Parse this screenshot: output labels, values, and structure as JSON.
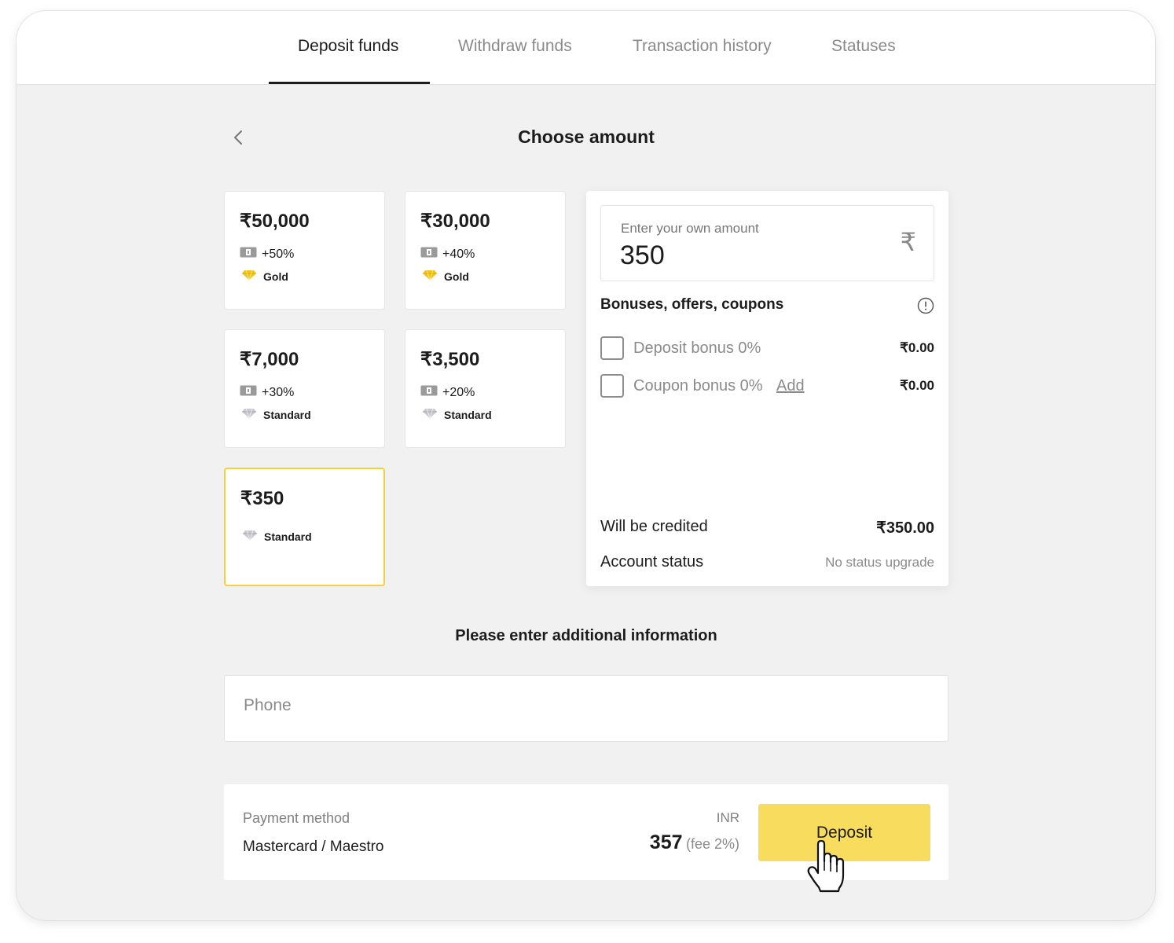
{
  "tabs": [
    {
      "label": "Deposit funds",
      "active": true
    },
    {
      "label": "Withdraw funds",
      "active": false
    },
    {
      "label": "Transaction history",
      "active": false
    },
    {
      "label": "Statuses",
      "active": false
    }
  ],
  "header": {
    "title": "Choose amount",
    "back_icon": "chevron-left-icon"
  },
  "amount_cards": [
    {
      "amount": "₹50,000",
      "bonus": "+50%",
      "tier": "Gold",
      "tier_icon": "gold-diamond-icon",
      "selected": false
    },
    {
      "amount": "₹30,000",
      "bonus": "+40%",
      "tier": "Gold",
      "tier_icon": "gold-diamond-icon",
      "selected": false
    },
    {
      "amount": "₹7,000",
      "bonus": "+30%",
      "tier": "Standard",
      "tier_icon": "silver-diamond-icon",
      "selected": false
    },
    {
      "amount": "₹3,500",
      "bonus": "+20%",
      "tier": "Standard",
      "tier_icon": "silver-diamond-icon",
      "selected": false
    },
    {
      "amount": "₹350",
      "tier": "Standard",
      "tier_icon": "silver-diamond-icon",
      "selected": true
    }
  ],
  "custom_amount": {
    "label": "Enter your own amount",
    "value": "350",
    "currency_symbol": "₹"
  },
  "bonuses": {
    "title": "Bonuses, offers, coupons",
    "info_icon": "info-circle-icon",
    "items": [
      {
        "label": "Deposit bonus 0%",
        "value": "₹0.00",
        "checked": false
      },
      {
        "label": "Coupon bonus 0%",
        "link": "Add",
        "value": "₹0.00",
        "checked": false
      }
    ]
  },
  "summary": {
    "credited_label": "Will be credited",
    "credited_value": "₹350.00",
    "status_label": "Account status",
    "status_value": "No status upgrade"
  },
  "additional": {
    "title": "Please enter additional information",
    "phone_placeholder": "Phone",
    "phone_value": ""
  },
  "payment": {
    "method_label": "Payment method",
    "method_value": "Mastercard / Maestro",
    "currency": "INR",
    "total": "357",
    "fee": "(fee 2%)",
    "button_label": "Deposit"
  },
  "colors": {
    "accent": "#f8dc5d",
    "selected_border": "#f5cf3c",
    "background": "#f1f1f1",
    "gold": "#f2c417"
  }
}
